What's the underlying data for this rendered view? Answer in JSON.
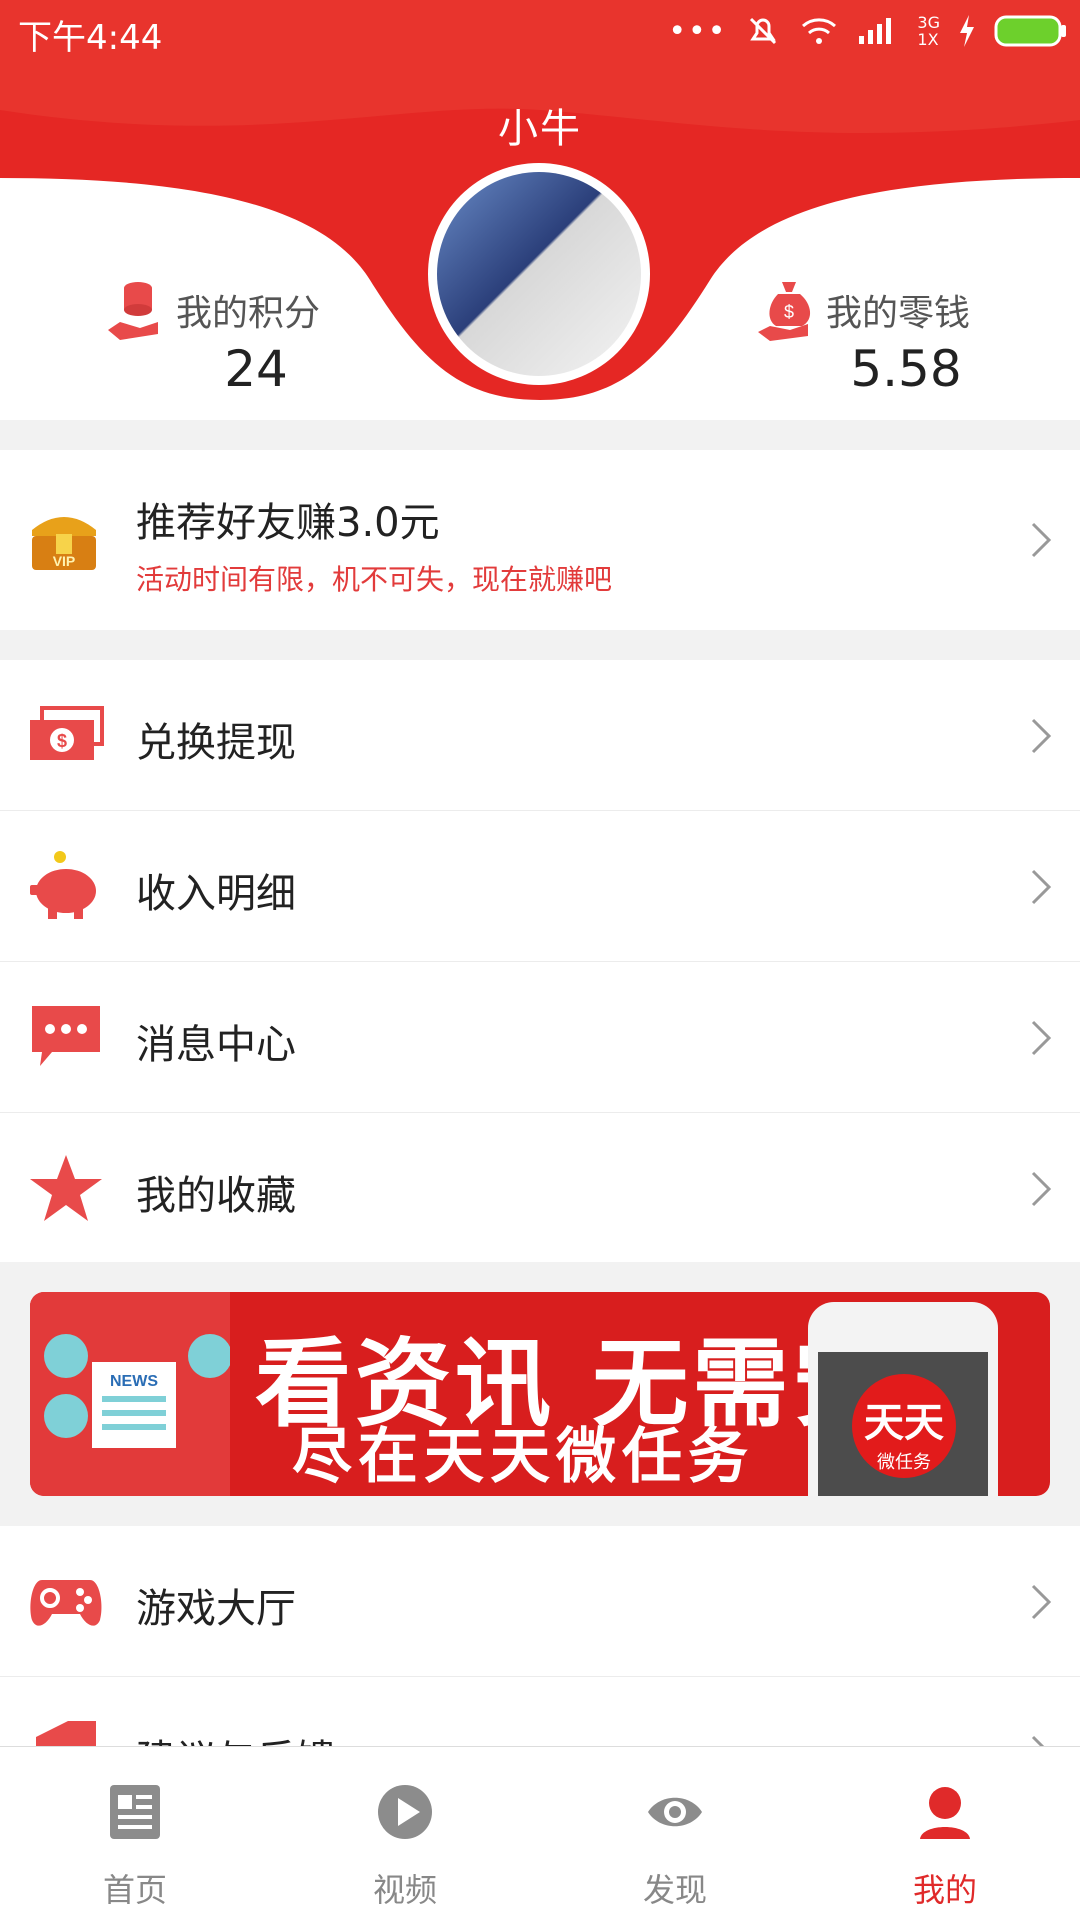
{
  "status_bar": {
    "time": "下午4:44",
    "network_top": "3G",
    "network_bottom": "1X"
  },
  "header": {
    "title": "小牛"
  },
  "stats": {
    "points": {
      "label": "我的积分",
      "value": "24"
    },
    "change": {
      "label": "我的零钱",
      "value": "5.58"
    }
  },
  "promo": {
    "title": "推荐好友赚3.0元",
    "subtitle": "活动时间有限，机不可失，现在就赚吧"
  },
  "menu": [
    {
      "label": "兑换提现",
      "icon": "cash-icon"
    },
    {
      "label": "收入明细",
      "icon": "piggy-bank-icon"
    },
    {
      "label": "消息中心",
      "icon": "message-icon"
    },
    {
      "label": "我的收藏",
      "icon": "star-icon"
    }
  ],
  "banner": {
    "headline": "看资讯 无需安装",
    "tagline": "尽在天天微任务",
    "logo_main": "天天",
    "logo_sub": "微任务"
  },
  "menu2": [
    {
      "label": "游戏大厅",
      "icon": "gamepad-icon"
    },
    {
      "label": "建议与反馈",
      "icon": "feedback-icon"
    }
  ],
  "tabs": [
    {
      "label": "首页",
      "icon": "news-icon"
    },
    {
      "label": "视频",
      "icon": "play-icon"
    },
    {
      "label": "发现",
      "icon": "eye-icon"
    },
    {
      "label": "我的",
      "icon": "user-icon",
      "active": true
    }
  ],
  "colors": {
    "primary": "#e02a2a",
    "accent_text": "#e23b3b"
  }
}
